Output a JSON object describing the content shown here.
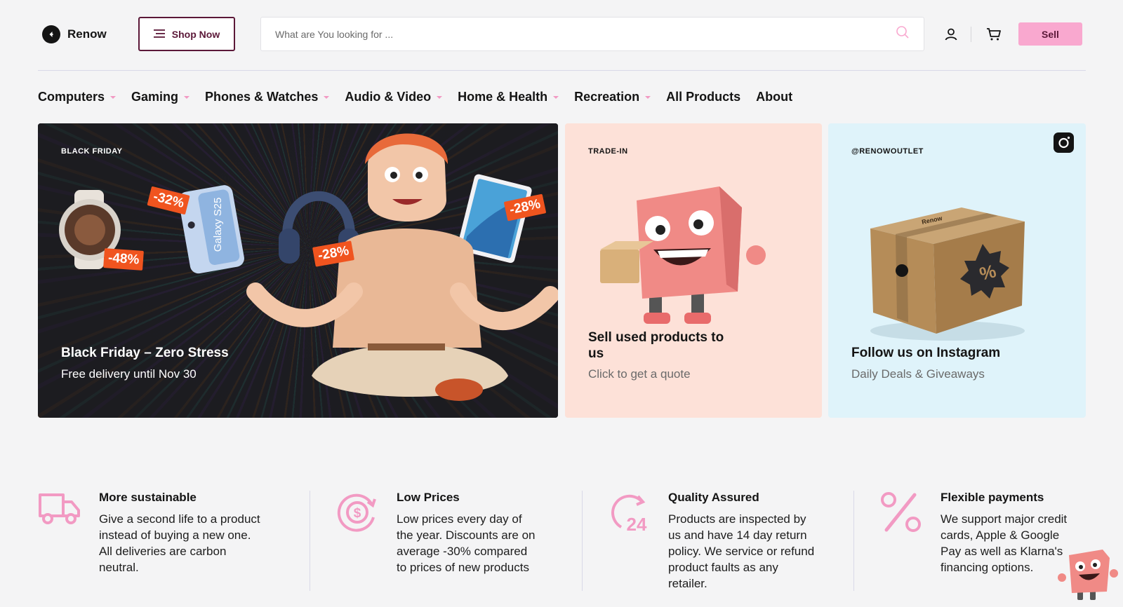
{
  "brand": {
    "name": "Renow",
    "accent": "#f9a8cf",
    "dark_accent": "#5b1838",
    "tag_color": "#f0541f"
  },
  "header": {
    "shop_now_label": "Shop Now",
    "search_placeholder": "What are You looking for ...",
    "search_value": "",
    "sell_label": "Sell",
    "icons": [
      "menu-icon",
      "search-icon",
      "user-icon",
      "cart-icon"
    ]
  },
  "nav": {
    "items": [
      {
        "label": "Computers",
        "dropdown": true
      },
      {
        "label": "Gaming",
        "dropdown": true
      },
      {
        "label": "Phones & Watches",
        "dropdown": true
      },
      {
        "label": "Audio & Video",
        "dropdown": true
      },
      {
        "label": "Home & Health",
        "dropdown": true
      },
      {
        "label": "Recreation",
        "dropdown": true
      },
      {
        "label": "All Products",
        "dropdown": false
      },
      {
        "label": "About",
        "dropdown": false
      }
    ]
  },
  "hero": {
    "black_friday": {
      "eyebrow": "BLACK FRIDAY",
      "title": "Black Friday – Zero Stress",
      "subtitle": "Free delivery until Nov 30",
      "tags": [
        "-32%",
        "-48%",
        "-28%",
        "-28%"
      ],
      "phone_text": "Galaxy S25"
    },
    "trade_in": {
      "eyebrow": "TRADE-IN",
      "title": "Sell used products to us",
      "subtitle": "Click to get a quote"
    },
    "instagram": {
      "eyebrow": "@RENOWOUTLET",
      "title": "Follow us on Instagram",
      "subtitle": "Daily Deals & Giveaways",
      "box_label": "Renow",
      "badge_symbol": "%"
    }
  },
  "features": [
    {
      "icon": "truck-icon",
      "title": "More sustainable",
      "text": "Give a second life to a product instead of buying a new one. All deliveries are carbon neutral."
    },
    {
      "icon": "dollar-cycle-icon",
      "title": "Low Prices",
      "text": "Low prices every day of the year. Discounts are on average -30% compared to prices of new products"
    },
    {
      "icon": "24-return-icon",
      "title": "Quality Assured",
      "text": "Products are inspected by us and have 14 day return policy. We service or refund product faults as any retailer."
    },
    {
      "icon": "percent-icon",
      "title": "Flexible payments",
      "text": "We support major credit cards, Apple & Google Pay as well as Klarna's financing options."
    }
  ]
}
